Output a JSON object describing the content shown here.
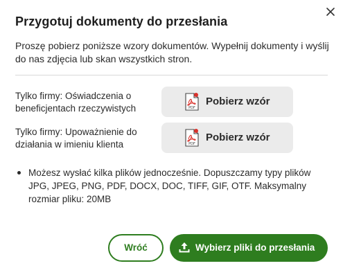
{
  "dialog": {
    "title": "Przygotuj dokumenty do przesłania",
    "intro": "Proszę pobierz poniższe wzory dokumentów. Wypełnij dokumenty i wyślij do nas zdjęcia lub skan wszystkich stron.",
    "close_icon": "close-icon"
  },
  "documents": [
    {
      "label": "Tylko firmy: Oświadczenia o beneficjentach rzeczywistych",
      "button": "Pobierz wzór",
      "icon": "pdf-file-icon",
      "icon_text": "PDF"
    },
    {
      "label": "Tylko firmy: Upoważnienie do działania w imieniu klienta",
      "button": "Pobierz wzór",
      "icon": "pdf-file-icon",
      "icon_text": "PDF"
    }
  ],
  "note": "Możesz wysłać kilka plików jednocześnie. Dopuszczamy typy plików JPG, JPEG, PNG, PDF, DOCX, DOC, TIFF, GIF, OTF. Maksymalny rozmiar pliku: 20MB",
  "actions": {
    "back_label": "Wróć",
    "upload_label": "Wybierz pliki do przesłania",
    "upload_icon": "upload-icon"
  },
  "colors": {
    "primary_green": "#2e7d1f",
    "button_grey": "#ebebeb",
    "pdf_red": "#d9312b"
  }
}
